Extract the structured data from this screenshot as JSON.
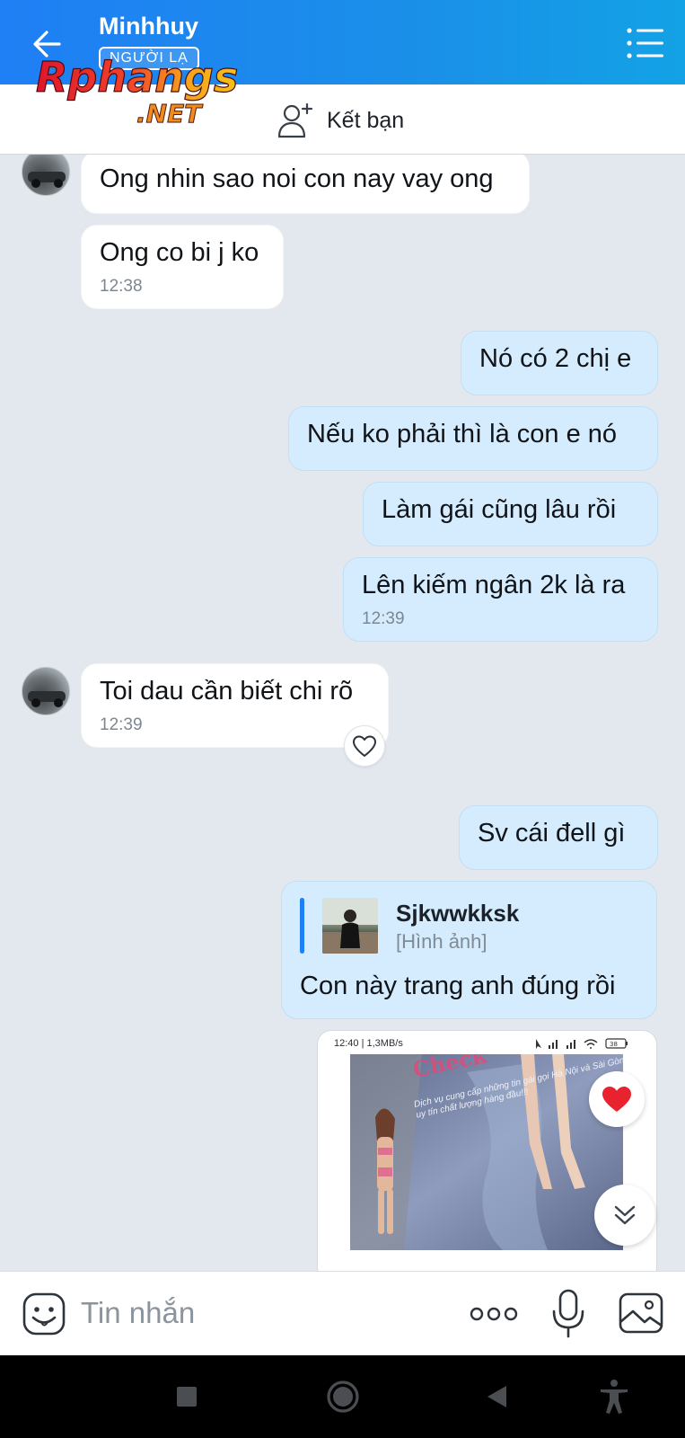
{
  "header": {
    "title": "Minhhuy",
    "badge": "NGƯỜI LẠ",
    "back_icon": "back-arrow-icon",
    "menu_icon": "menu-icon"
  },
  "watermark": {
    "brand": "Rphangs",
    "suffix": ".NET"
  },
  "friend_bar": {
    "label": "Kết bạn",
    "icon": "add-friend-icon"
  },
  "messages": [
    {
      "side": "in",
      "text": "Ong nhin sao noi con nay vay ong",
      "time": ""
    },
    {
      "side": "in",
      "text": "Ong co bi j ko",
      "time": "12:38"
    },
    {
      "side": "out",
      "text": "Nó có 2 chị e",
      "time": ""
    },
    {
      "side": "out",
      "text": "Nếu ko phải thì là con e nó",
      "time": ""
    },
    {
      "side": "out",
      "text": "Làm gái cũng lâu rồi",
      "time": ""
    },
    {
      "side": "out",
      "text": "Lên kiếm ngân 2k là ra",
      "time": "12:39"
    },
    {
      "side": "in",
      "text": "Toi dau cần biết chi rõ",
      "time": "12:39"
    },
    {
      "side": "out",
      "text": "Sv cái đell gì",
      "time": ""
    }
  ],
  "reply": {
    "quoted_name": "Sjkwwkksk",
    "quoted_type": "[Hình ảnh]",
    "text": "Con này trang anh đúng rồi"
  },
  "image_message": {
    "status_text": "12:40 | 1,3MB/s",
    "battery": "38",
    "caption": "Dịch vụ cung cấp những tin gái gọi Hà Nội và Sài Gòn uy tín chất lượng hàng đầu!!!"
  },
  "input": {
    "placeholder": "Tin nhắn"
  },
  "colors": {
    "header_blue": "#1f7ff5",
    "outgoing_bubble": "#d4ecfd",
    "incoming_bubble": "#ffffff",
    "chat_background": "#e2e8ee",
    "heart_red": "#e8222e"
  }
}
